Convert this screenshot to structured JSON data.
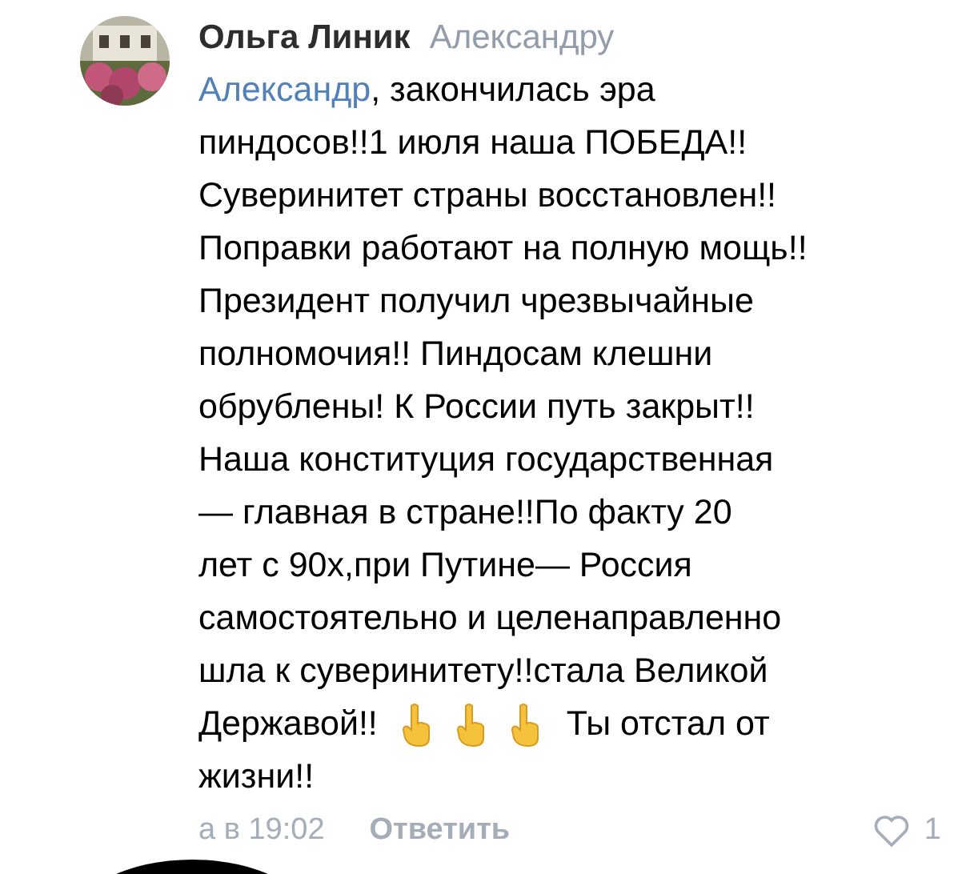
{
  "comment": {
    "author": "Ольга Линик",
    "reply_to": "Александру",
    "lines": [
      [
        {
          "kind": "mention",
          "text": "Александр"
        },
        {
          "kind": "text",
          "text": ", закончилась эра"
        }
      ],
      [
        {
          "kind": "text",
          "text": "пиндосов!!1 июля наша ПОБЕДА!!"
        }
      ],
      [
        {
          "kind": "text",
          "text": "Суверинитет страны восстановлен!!"
        }
      ],
      [
        {
          "kind": "text",
          "text": "Поправки работают на полную мощь!!"
        }
      ],
      [
        {
          "kind": "text",
          "text": "Президент получил чрезвычайные"
        }
      ],
      [
        {
          "kind": "text",
          "text": "полномочия!! Пиндосам клешни"
        }
      ],
      [
        {
          "kind": "text",
          "text": "обрублены! К России путь закрыт!!"
        }
      ],
      [
        {
          "kind": "text",
          "text": "Наша конституция государственная"
        }
      ],
      [
        {
          "kind": "text",
          "text": "— главная в стране!!По факту 20"
        }
      ],
      [
        {
          "kind": "text",
          "text": "лет с 90х,при Путине— Россия"
        }
      ],
      [
        {
          "kind": "text",
          "text": "самостоятельно и целенаправленно"
        }
      ],
      [
        {
          "kind": "text",
          "text": "шла к суверинитету!!стала Великой"
        }
      ],
      [
        {
          "kind": "text",
          "text": "Державой!!"
        },
        {
          "kind": "emoji"
        },
        {
          "kind": "emoji"
        },
        {
          "kind": "emoji"
        },
        {
          "kind": "text",
          "text": "Ты отстал от"
        }
      ],
      [
        {
          "kind": "text",
          "text": "жизни!!"
        }
      ]
    ],
    "time": "а в 19:02",
    "reply_label": "Ответить",
    "liked": false,
    "likes": "1"
  }
}
